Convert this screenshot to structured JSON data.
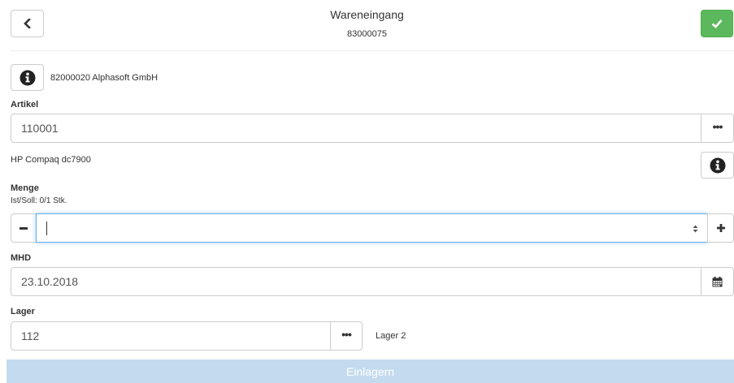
{
  "header": {
    "title": "Wareneingang",
    "subtitle": "83000075"
  },
  "supplier": {
    "text": "82000020 Alphasoft GmbH"
  },
  "artikel": {
    "label": "Artikel",
    "value": "110001",
    "description": "HP Compaq dc7900"
  },
  "menge": {
    "label": "Menge",
    "hint": "Ist/Soll: 0/1 Stk.",
    "value": ""
  },
  "mhd": {
    "label": "MHD",
    "value": "23.10.2018"
  },
  "lager": {
    "label": "Lager",
    "value": "112",
    "name": "Lager 2"
  },
  "submit_label": "Einlagern",
  "colors": {
    "success": "#5cb85c",
    "submit_disabled": "#c3dbee",
    "focus_border": "#66afe9"
  },
  "icons": {
    "back": "chevron-left-icon",
    "confirm": "check-icon",
    "info": "info-circle-icon",
    "browse": "ellipsis-icon",
    "minus": "minus-icon",
    "plus": "plus-icon",
    "calendar": "calendar-icon"
  }
}
